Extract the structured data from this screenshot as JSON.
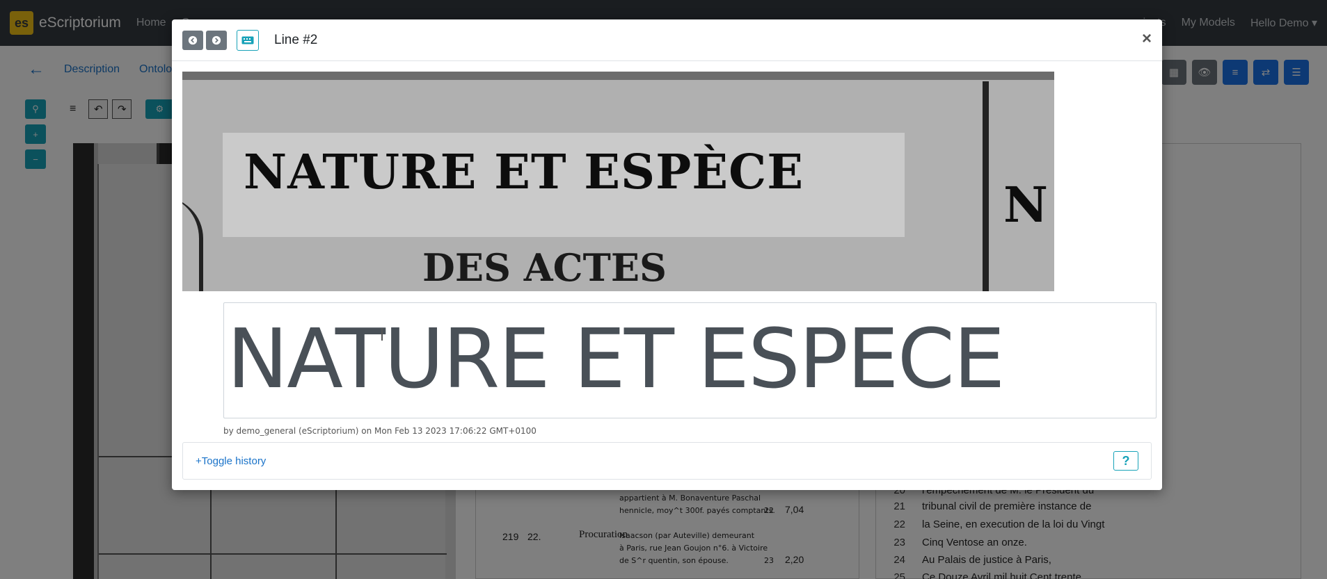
{
  "app": {
    "brand": "eScriptorium",
    "logo_text": "es",
    "nav_left": [
      "Home",
      "C"
    ],
    "nav_right": [
      "jects",
      "My Models",
      "Hello Demo ▾"
    ]
  },
  "subnav": {
    "tabs": [
      "Description",
      "Ontolo"
    ]
  },
  "transcription_panel": {
    "rows": [
      {
        "text": "appartient à M. Bonaventure Paschal"
      },
      {
        "text": "hennicle, moy^t 300f. payés comptants.",
        "n": "22",
        "v": "7,04"
      },
      {
        "num": "219",
        "num2": "22.",
        "label": "Procuration",
        "text": "Isaacson (par Auteville) demeurant"
      },
      {
        "text": "à Paris, rue Jean Goujon n°6. à Victoire"
      },
      {
        "text": "de S^r quentin, son épouse.",
        "n": "23",
        "v": "2,20"
      }
    ]
  },
  "text_panel": {
    "lines": [
      {
        "n": "20",
        "text": "l'empêchement de M. le Président du"
      },
      {
        "n": "21",
        "text": "tribunal civil de première instance de"
      },
      {
        "n": "22",
        "text": "la Seine, en execution de la loi du Vingt"
      },
      {
        "n": "23",
        "text": "Cinq Ventose an onze."
      },
      {
        "n": "24",
        "text": "Au Palais de justice à Paris,"
      },
      {
        "n": "25",
        "text": "Ce Douze Avril mil huit Cent trente"
      }
    ]
  },
  "modal": {
    "title": "Line #2",
    "close": "×",
    "scan_text_line1": "NATURE ET ESPÈCE",
    "scan_text_line2": "DES ACTES",
    "scan_text_right": "N",
    "transcription_value": "NATURE ET ESPECE",
    "byline": "by demo_general (eScriptorium) on Mon Feb 13 2023 17:06:22 GMT+0100",
    "toggle_history": "+Toggle history",
    "help": "?"
  }
}
